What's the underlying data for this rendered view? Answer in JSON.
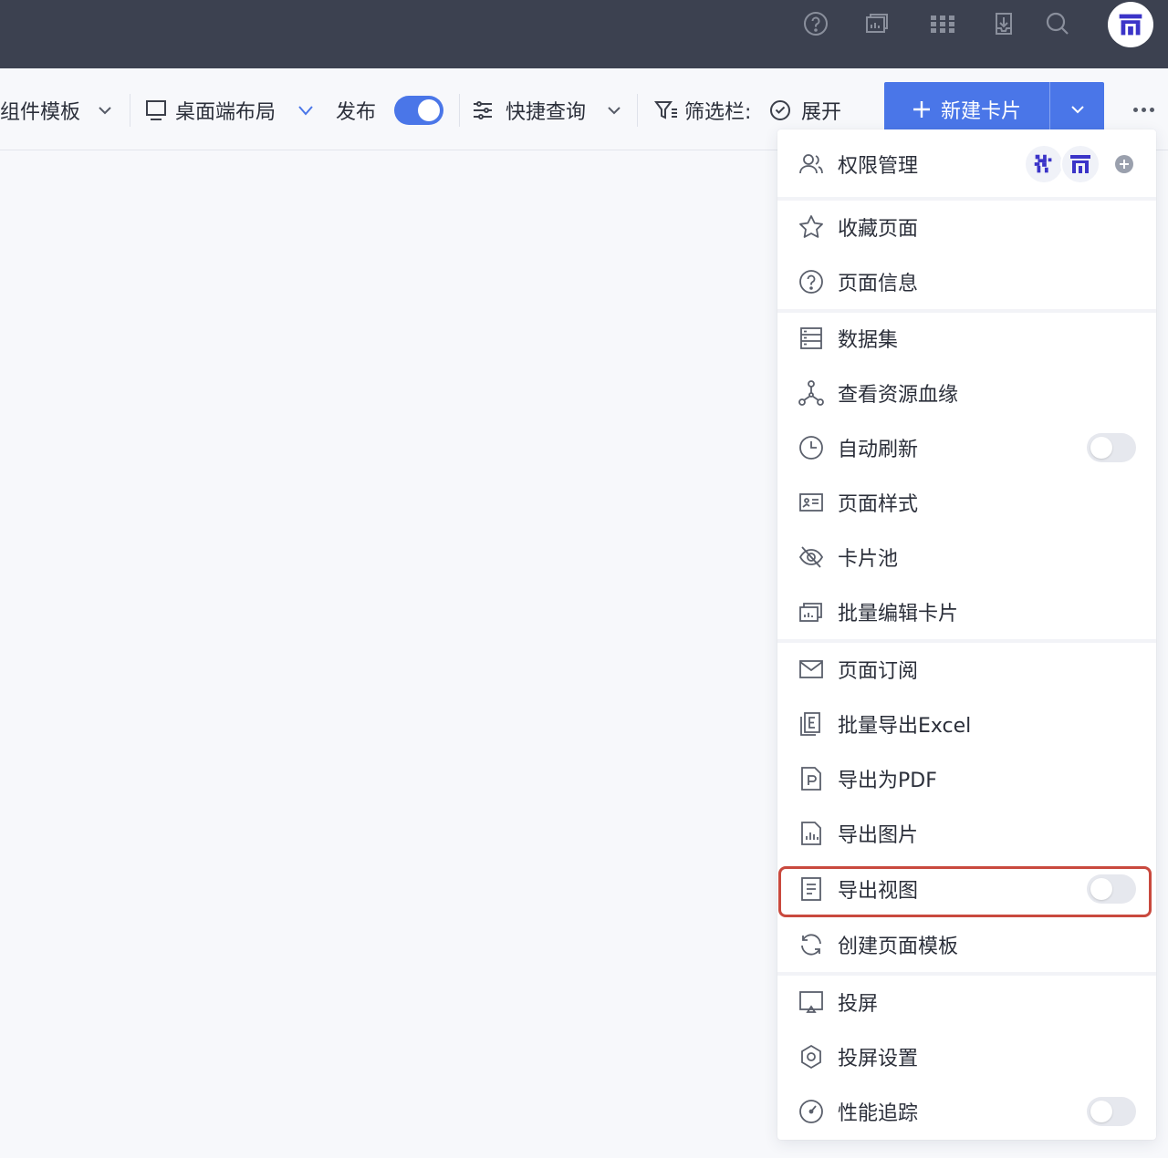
{
  "header": {
    "icons": [
      "help-icon",
      "dashboard-icon",
      "apps-grid-icon",
      "download-box-icon",
      "search-icon",
      "user-avatar"
    ]
  },
  "toolbar": {
    "component_template_label": "组件模板",
    "desktop_layout_label": "桌面端布局",
    "publish_label": "发布",
    "publish_enabled": true,
    "quick_query_label": "快捷查询",
    "filter_bar_label": "筛选栏:",
    "expand_label": "展开",
    "new_card_label": "新建卡片"
  },
  "menu": {
    "permission": "权限管理",
    "favorite": "收藏页面",
    "page_info": "页面信息",
    "dataset": "数据集",
    "lineage": "查看资源血缘",
    "auto_refresh": "自动刷新",
    "auto_refresh_on": false,
    "page_style": "页面样式",
    "card_pool": "卡片池",
    "batch_edit": "批量编辑卡片",
    "subscribe": "页面订阅",
    "export_excel": "批量导出Excel",
    "export_pdf": "导出为PDF",
    "export_image": "导出图片",
    "export_view": "导出视图",
    "export_view_on": false,
    "create_template": "创建页面模板",
    "cast": "投屏",
    "cast_settings": "投屏设置",
    "perf_trace": "性能追踪",
    "perf_trace_on": false
  },
  "colors": {
    "accent": "#4a76e8",
    "header_bg": "#3c4150",
    "highlight": "#c9493e"
  }
}
